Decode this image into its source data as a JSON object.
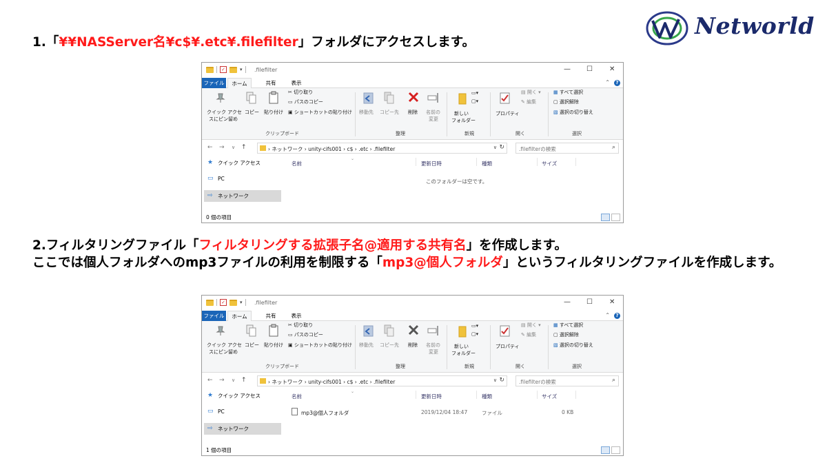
{
  "logo": {
    "text": "Networld"
  },
  "step1": {
    "prefix": "1.「",
    "highlight": "¥¥NASServer名¥c$¥.etc¥.filefilter",
    "suffix": "」フォルダにアクセスします。"
  },
  "step2": {
    "line1_prefix": "2.フィルタリングファイル「",
    "line1_highlight": "フィルタリングする拡張子名@適用する共有名",
    "line1_suffix": "」を作成します。",
    "line2_prefix": "ここでは個人フォルダへのmp3ファイルの利用を制限する「",
    "line2_highlight": "mp3@個人フォルダ",
    "line2_suffix": "」というフィルタリングファイルを作成します。"
  },
  "explorer": {
    "title": ".filefilter",
    "window_controls": {
      "minimize": "—",
      "maximize": "☐",
      "close": "✕"
    },
    "tabs": {
      "file": "ファイル",
      "home": "ホーム",
      "share": "共有",
      "view": "表示"
    },
    "ribbon": {
      "pin_line1": "クイック アクセ",
      "pin_line2": "スにピン留め",
      "copy": "コピー",
      "paste": "貼り付け",
      "cut": "切り取り",
      "copy_path": "パスのコピー",
      "paste_shortcut": "ショートカットの貼り付け",
      "move_to": "移動先",
      "copy_to": "コピー先",
      "delete": "削除",
      "rename_line1": "名前の",
      "rename_line2": "変更",
      "new_folder_line1": "新しい",
      "new_folder_line2": "フォルダー",
      "properties": "プロパティ",
      "open": "開く",
      "edit": "編集",
      "select_all": "すべて選択",
      "select_none": "選択解除",
      "invert_selection": "選択の切り替え",
      "groups": {
        "clipboard": "クリップボード",
        "organize": "整理",
        "new": "新規",
        "open": "開く",
        "select": "選択"
      }
    },
    "address": {
      "crumbs": "›  ネットワーク  ›  unity-cifs001  ›  c$  ›  .etc  ›  .filefilter",
      "search_placeholder": ".filefilterの検索"
    },
    "nav_pane": {
      "quick_access": "クイック アクセス",
      "pc": "PC",
      "network": "ネットワーク"
    },
    "columns": {
      "name": "名前",
      "modified": "更新日時",
      "type": "種類",
      "size": "サイズ"
    }
  },
  "window1": {
    "empty_message": "このフォルダーは空です。",
    "status": "0 個の項目"
  },
  "window2": {
    "files": [
      {
        "name": "mp3@個人フォルダ",
        "modified": "2019/12/04 18:47",
        "type": "ファイル",
        "size": "0 KB"
      }
    ],
    "status": "1 個の項目"
  }
}
